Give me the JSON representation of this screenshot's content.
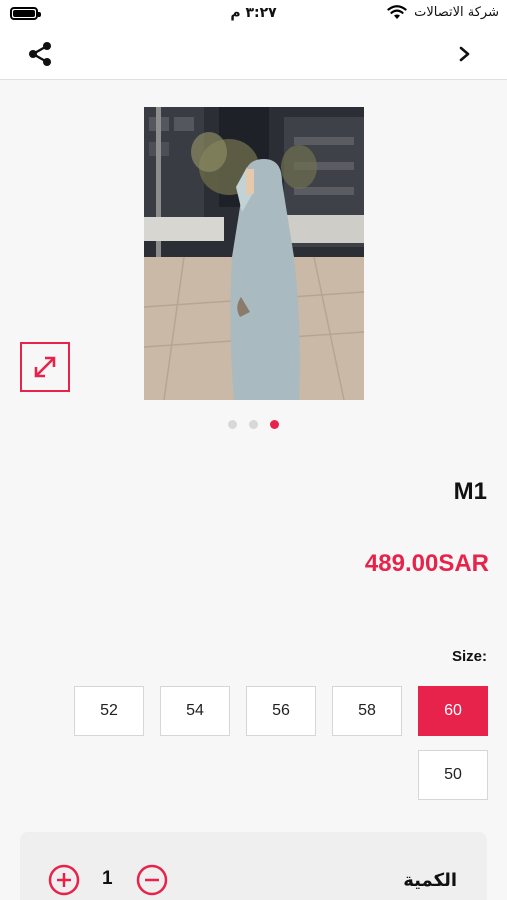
{
  "status_bar": {
    "time": "٣:٢٧ م",
    "carrier": "شركة الاتصالات"
  },
  "nav": {
    "icons": [
      "share-icon",
      "chevron-right-icon"
    ]
  },
  "gallery": {
    "image_count": 3,
    "active_index": 2
  },
  "product": {
    "name": "M1",
    "price": "489.00SAR"
  },
  "size": {
    "label": "Size:",
    "options": [
      "60",
      "58",
      "56",
      "54",
      "52",
      "50"
    ],
    "selected": "60"
  },
  "quantity": {
    "label": "الكمية",
    "value": "1"
  },
  "colors": {
    "accent": "#e8234b",
    "background": "#f7f7f7"
  }
}
